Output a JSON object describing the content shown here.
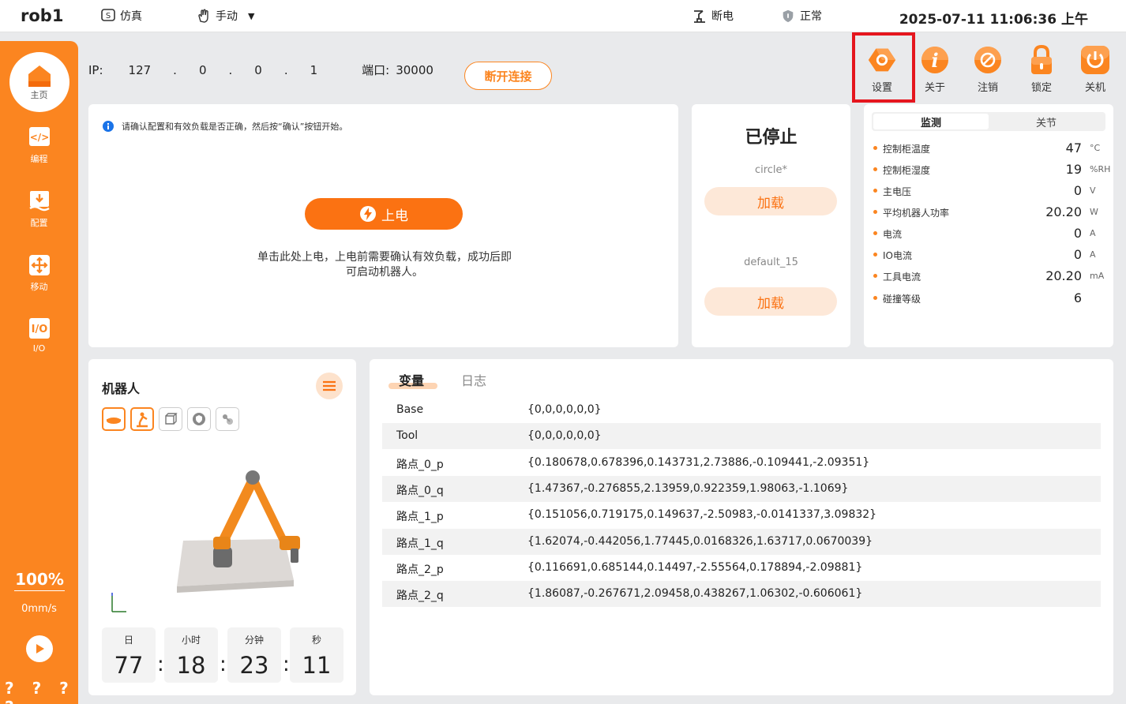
{
  "topbar": {
    "robot_name": "rob1",
    "sim_label": "仿真",
    "mode_label": "手动",
    "power_label": "断电",
    "safety_label": "正常",
    "datetime": "2025-07-11 11:06:36 上午"
  },
  "sidebar": {
    "items": [
      {
        "label": "主页",
        "icon": "home-icon"
      },
      {
        "label": "编程",
        "icon": "code-icon"
      },
      {
        "label": "配置",
        "icon": "config-icon"
      },
      {
        "label": "移动",
        "icon": "move-icon"
      },
      {
        "label": "I/O",
        "icon": "io-icon"
      }
    ],
    "speed_percent": "100%",
    "speed_value": "0mm/s",
    "status_marks": "? ? ? ?"
  },
  "connection": {
    "ip_label": "IP:",
    "ip": [
      "127",
      ".",
      "0",
      ".",
      "0",
      ".",
      "1"
    ],
    "port_label": "端口:",
    "port": "30000",
    "disconnect_label": "断开连接"
  },
  "toolbar": {
    "buttons": [
      {
        "label": "设置",
        "icon": "settings-icon"
      },
      {
        "label": "关于",
        "icon": "info-icon"
      },
      {
        "label": "注销",
        "icon": "logout-icon"
      },
      {
        "label": "锁定",
        "icon": "lock-icon"
      },
      {
        "label": "关机",
        "icon": "power-icon"
      }
    ]
  },
  "power_panel": {
    "notice": "请确认配置和有效负载是否正确，然后按“确认”按钮开始。",
    "power_on_label": "上电",
    "tip": "单击此处上电，上电前需要确认有效负载，成功后即可启动机器人。"
  },
  "program_panel": {
    "status": "已停止",
    "program_name": "circle*",
    "load_label_1": "加载",
    "payload_name": "default_15",
    "load_label_2": "加载"
  },
  "monitor": {
    "tab_monitor": "监测",
    "tab_joints": "关节",
    "rows": [
      {
        "label": "控制柜温度",
        "value": "47",
        "unit": "°C"
      },
      {
        "label": "控制柜湿度",
        "value": "19",
        "unit": "%RH"
      },
      {
        "label": "主电压",
        "value": "0",
        "unit": "V"
      },
      {
        "label": "平均机器人功率",
        "value": "20.20",
        "unit": "W"
      },
      {
        "label": "电流",
        "value": "0",
        "unit": "A"
      },
      {
        "label": "IO电流",
        "value": "0",
        "unit": "A"
      },
      {
        "label": "工具电流",
        "value": "20.20",
        "unit": "mA"
      },
      {
        "label": "碰撞等级",
        "value": "6",
        "unit": ""
      }
    ]
  },
  "robot_panel": {
    "title": "机器人",
    "timer": {
      "days_label": "日",
      "days": "77",
      "hours_label": "小时",
      "hours": "18",
      "minutes_label": "分钟",
      "minutes": "23",
      "seconds_label": "秒",
      "seconds": "11",
      "sep": ":"
    }
  },
  "variables": {
    "tab_vars": "变量",
    "tab_log": "日志",
    "rows": [
      {
        "name": "Base",
        "value": "{0,0,0,0,0,0}"
      },
      {
        "name": "Tool",
        "value": "{0,0,0,0,0,0}"
      },
      {
        "name": "路点_0_p",
        "value": "{0.180678,0.678396,0.143731,2.73886,-0.109441,-2.09351}"
      },
      {
        "name": "路点_0_q",
        "value": "{1.47367,-0.276855,2.13959,0.922359,1.98063,-1.1069}"
      },
      {
        "name": "路点_1_p",
        "value": "{0.151056,0.719175,0.149637,-2.50983,-0.0141337,3.09832}"
      },
      {
        "name": "路点_1_q",
        "value": "{1.62074,-0.442056,1.77445,0.0168326,1.63717,0.0670039}"
      },
      {
        "name": "路点_2_p",
        "value": "{0.116691,0.685144,0.14497,-2.55564,0.178894,-2.09881}"
      },
      {
        "name": "路点_2_q",
        "value": "{1.86087,-0.267671,2.09458,0.438267,1.06302,-0.606061}"
      }
    ]
  },
  "colors": {
    "accent": "#fb8520",
    "highlight": "#e5161e"
  }
}
